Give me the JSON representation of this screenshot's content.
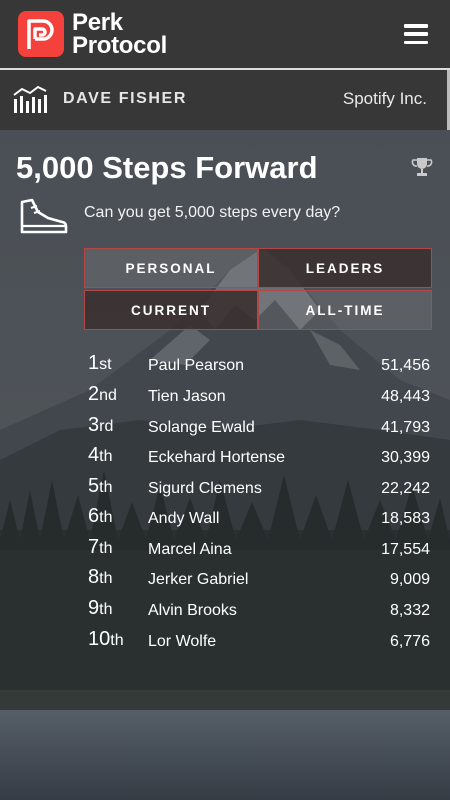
{
  "header": {
    "logo_line1": "Perk",
    "logo_line2": "Protocol",
    "menu_icon": "hamburger-icon"
  },
  "user": {
    "name": "DAVE FISHER",
    "company": "Spotify Inc.",
    "icon": "bar-chart-icon"
  },
  "challenge": {
    "title": "5,000 Steps Forward",
    "description": "Can you get 5,000 steps every day?",
    "trophy_icon": "trophy-icon",
    "shoe_icon": "sneaker-icon"
  },
  "toggles": {
    "personal": "PERSONAL",
    "leaders": "LEADERS",
    "current": "CURRENT",
    "all_time": "ALL-TIME"
  },
  "leaderboard": [
    {
      "rank": "1",
      "suffix": "st",
      "name": "Paul Pearson",
      "steps": "51,456"
    },
    {
      "rank": "2",
      "suffix": "nd",
      "name": "Tien Jason",
      "steps": "48,443"
    },
    {
      "rank": "3",
      "suffix": "rd",
      "name": "Solange Ewald",
      "steps": "41,793"
    },
    {
      "rank": "4",
      "suffix": "th",
      "name": "Eckehard Hortense",
      "steps": "30,399"
    },
    {
      "rank": "5",
      "suffix": "th",
      "name": "Sigurd Clemens",
      "steps": "22,242"
    },
    {
      "rank": "6",
      "suffix": "th",
      "name": "Andy Wall",
      "steps": "18,583"
    },
    {
      "rank": "7",
      "suffix": "th",
      "name": "Marcel Aina",
      "steps": "17,554"
    },
    {
      "rank": "8",
      "suffix": "th",
      "name": "Jerker Gabriel",
      "steps": "9,009"
    },
    {
      "rank": "9",
      "suffix": "th",
      "name": "Alvin Brooks",
      "steps": "8,332"
    },
    {
      "rank": "10",
      "suffix": "th",
      "name": "Lor Wolfe",
      "steps": "6,776"
    }
  ],
  "colors": {
    "brand_red": "#f5413b",
    "header_bg": "#373737",
    "toggle_border": "#b04848"
  }
}
